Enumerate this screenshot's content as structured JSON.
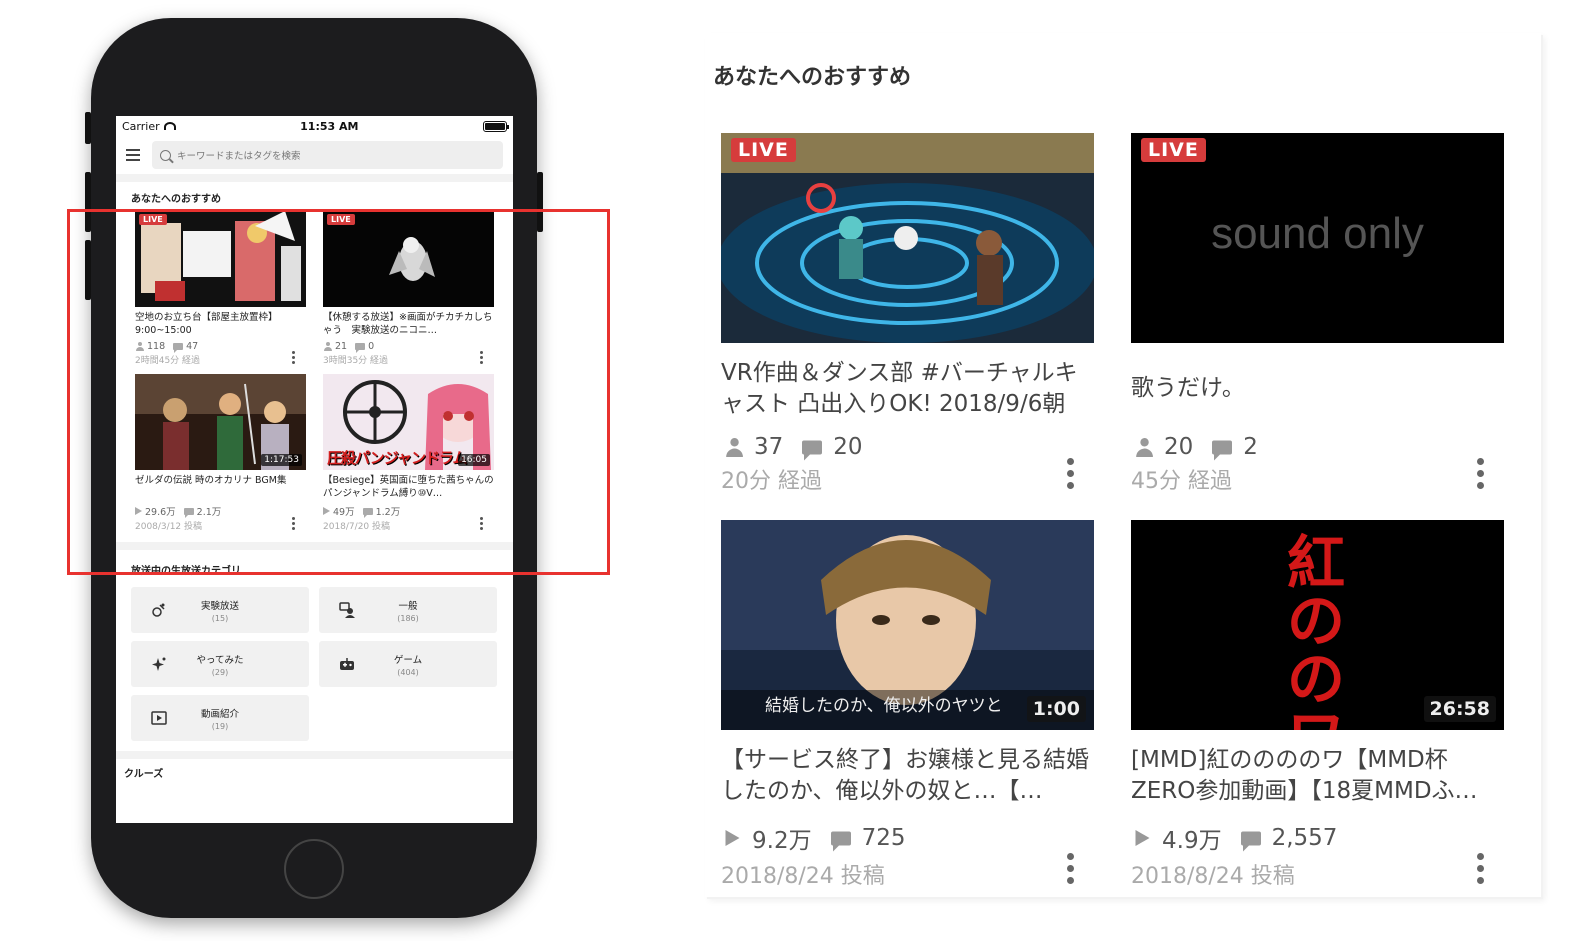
{
  "status_bar": {
    "carrier": "Carrier",
    "time": "11:53 AM"
  },
  "search": {
    "placeholder": "キーワードまたはタグを検索"
  },
  "recommend": {
    "title": "あなたへのおすすめ",
    "items": [
      {
        "badge": "LIVE",
        "title": "空地のお立ち台【部屋主放置枠】9:00~15:00",
        "stat1": "118",
        "stat2": "47",
        "sub": "2時間45分 経過"
      },
      {
        "badge": "LIVE",
        "title": "【休憩する放送】※画面がチカチカしちゃう　実験放送のニコニ…",
        "stat1": "21",
        "stat2": "0",
        "sub": "3時間35分 経過"
      },
      {
        "duration": "1:17:53",
        "title": "ゼルダの伝説 時のオカリナ BGM集",
        "stat1": "29.6万",
        "stat2": "2.1万",
        "sub": "2008/3/12 投稿"
      },
      {
        "duration": "16:05",
        "title": "【Besiege】英国面に堕ちた茜ちゃんのパンジャンドラム縛り⑩V…",
        "stat1": "49万",
        "stat2": "1.2万",
        "sub": "2018/7/20 投稿",
        "thumb_text": "圧殺パンジャンドラム"
      }
    ]
  },
  "categories": {
    "title": "放送中の生放送カテゴリ",
    "items": [
      {
        "name": "実験放送",
        "count": "(15)",
        "icon": "experiment-icon"
      },
      {
        "name": "一般",
        "count": "(186)",
        "icon": "chat-person-icon"
      },
      {
        "name": "やってみた",
        "count": "(29)",
        "icon": "sparkle-icon"
      },
      {
        "name": "ゲーム",
        "count": "(404)",
        "icon": "game-controller-icon"
      },
      {
        "name": "動画紹介",
        "count": "(19)",
        "icon": "video-play-icon"
      }
    ]
  },
  "cruise": {
    "title": "クルーズ"
  },
  "zoom": {
    "title": "あなたへのおすすめ",
    "items": [
      {
        "badge": "LIVE",
        "title": "VR作曲＆ダンス部 #バーチャルキャスト 凸出入りOK! 2018/9/6朝",
        "stat1": "37",
        "stat2": "20",
        "sub": "20分 経過"
      },
      {
        "badge": "LIVE",
        "title": "歌うだけ。",
        "stat1": "20",
        "stat2": "2",
        "sub": "45分 経過",
        "thumb_text": "sound only"
      },
      {
        "duration": "1:00",
        "title": "【サービス終了】お嬢様と見る結婚したのか、俺以外の奴と…【…",
        "stat1": "9.2万",
        "stat2": "725",
        "sub": "2018/8/24 投稿",
        "thumb_text": "結婚したのか、俺以外のヤツと"
      },
      {
        "duration": "26:58",
        "title": "[MMD]紅ののののワ【MMD杯ZERO参加動画】【18夏MMDふ…",
        "stat1": "4.9万",
        "stat2": "2,557",
        "sub": "2018/8/24 投稿",
        "thumb_text": "紅ののワ"
      }
    ]
  },
  "colors": {
    "live_red": "#d63c3c",
    "highlight_red": "#e8322f"
  }
}
